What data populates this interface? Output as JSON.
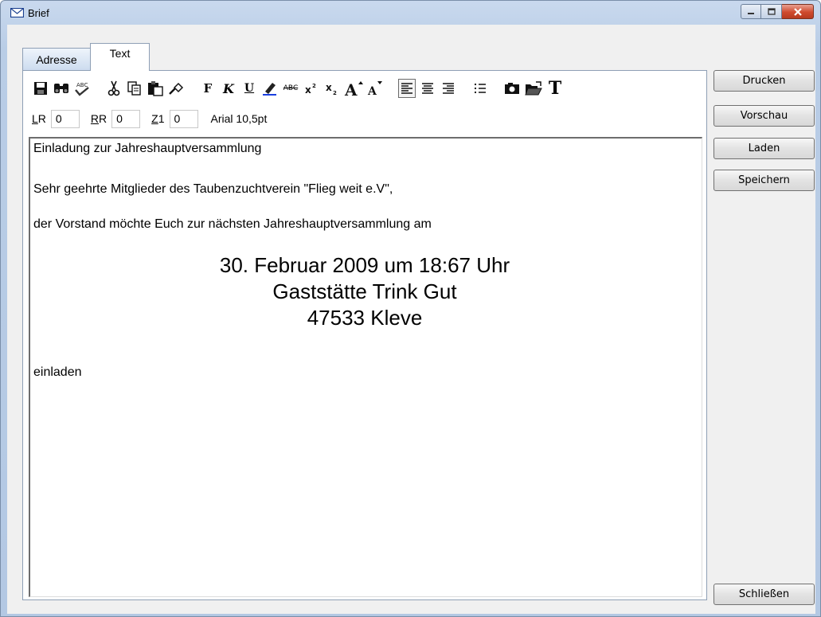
{
  "window": {
    "title": "Brief",
    "controls": [
      "minimize",
      "maximize",
      "close"
    ]
  },
  "tabs": [
    {
      "label": "Adresse",
      "active": false
    },
    {
      "label": "Text",
      "active": true
    }
  ],
  "toolbar": {
    "icons": [
      "save-icon",
      "find-icon",
      "spellcheck-icon",
      "cut-icon",
      "copy-icon",
      "paste-icon",
      "format-brush-icon",
      "bold-icon",
      "italic-icon",
      "underline-icon",
      "highlight-icon",
      "strikethrough-icon",
      "superscript-icon",
      "subscript-icon",
      "font-grow-icon",
      "font-shrink-icon",
      "align-left-icon",
      "align-center-icon",
      "align-right-icon",
      "bullet-list-icon",
      "insert-image-icon",
      "open-folder-icon",
      "font-icon"
    ],
    "bold_glyph": "F",
    "italic_glyph": "K",
    "underline_glyph": "U",
    "strike_glyph": "ABC",
    "font_glyph": "T"
  },
  "fields": {
    "lr": {
      "label_u": "L",
      "label_rest": "R",
      "value": "0"
    },
    "rr": {
      "label_u": "R",
      "label_rest": "R",
      "value": "0"
    },
    "z1": {
      "label_u": "Z",
      "label_rest": "1",
      "value": "0"
    },
    "font_info": "Arial 10,5pt"
  },
  "document": {
    "line1": "Einladung zur Jahreshauptversammlung",
    "line2": "Sehr geehrte Mitglieder des Taubenzuchtverein \"Flieg weit e.V\",",
    "line3": "der Vorstand möchte Euch zur nächsten Jahreshauptversammlung am",
    "center1": "30. Februar 2009 um 18:67 Uhr",
    "center2": "Gaststätte Trink Gut",
    "center3": "47533 Kleve",
    "line4": "einladen"
  },
  "buttons": {
    "print": "Drucken",
    "preview": "Vorschau",
    "load": "Laden",
    "save": "Speichern",
    "close": "Schließen"
  }
}
